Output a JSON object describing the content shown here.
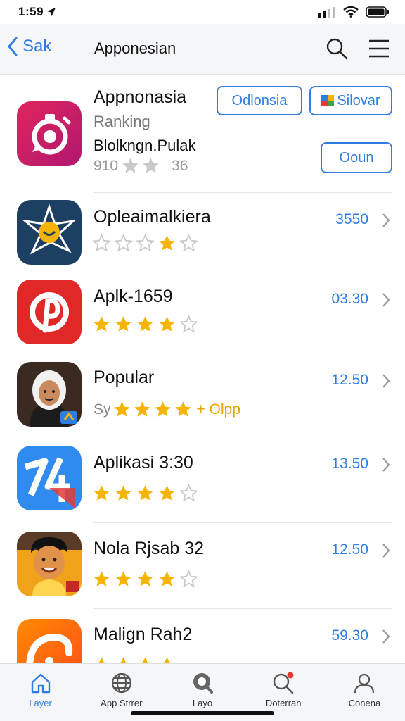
{
  "status": {
    "time": "1:59"
  },
  "nav": {
    "back_label": "Sak",
    "title": "Apponesian"
  },
  "featured": {
    "name": "Appnonasia",
    "line1": "Ranking",
    "line2": "Blolkngn.Pulak",
    "rating_prefix": "910",
    "rating_count": "36",
    "rating": 2,
    "buttons": {
      "primary": "Odlonsia",
      "secondary": "Silovar",
      "open": "Ooun"
    }
  },
  "apps": [
    {
      "name": "Opleaimalkiera",
      "price": "3550",
      "rating": 4,
      "filled_index_only": true
    },
    {
      "name": "Aplk-1659",
      "price": "03.30",
      "rating": 4
    },
    {
      "name": "Popular",
      "price": "12.50",
      "rating": 4,
      "rating_prefix": "Sy",
      "rating_suffix": "+ Olpp"
    },
    {
      "name": "Aplikasi 3:30",
      "price": "13.50",
      "rating": 4
    },
    {
      "name": "Nola Rjsab 32",
      "price": "12.50",
      "rating": 4
    },
    {
      "name": "Malign Rah2",
      "price": "59.30",
      "rating": 4
    }
  ],
  "tabs": [
    {
      "label": "Layer",
      "icon": "home-icon",
      "active": true
    },
    {
      "label": "App Strrer",
      "icon": "globe-icon"
    },
    {
      "label": "Layo",
      "icon": "magnifier-badge-icon"
    },
    {
      "label": "Doterran",
      "icon": "search-icon"
    },
    {
      "label": "Conena",
      "icon": "person-icon"
    }
  ],
  "colors": {
    "accent": "#2f7de1",
    "star": "#f4b400",
    "star_empty": "#c9c9c9"
  }
}
